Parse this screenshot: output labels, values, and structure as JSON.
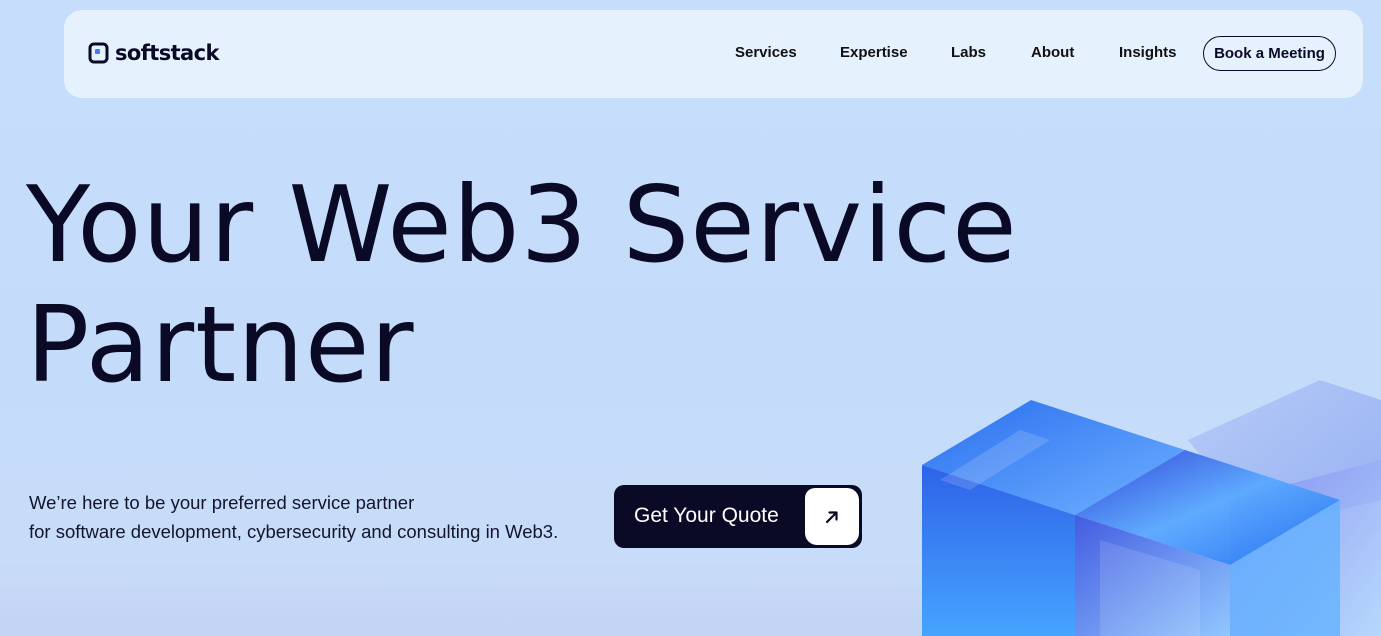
{
  "brand": {
    "name": "softstack",
    "logo_icon": "softstack-logo-icon"
  },
  "nav": {
    "items": [
      {
        "label": "Services"
      },
      {
        "label": "Expertise"
      },
      {
        "label": "Labs"
      },
      {
        "label": "About"
      },
      {
        "label": "Insights"
      }
    ],
    "cta_label": "Book a Meeting"
  },
  "hero": {
    "title_line1": "Your Web3 Service",
    "title_line2": "Partner",
    "subtitle_line1": "We’re here to be your preferred service partner",
    "subtitle_line2": "for software development, cybersecurity and consulting in Web3.",
    "cta_label": "Get Your Quote",
    "cta_icon": "arrow-up-right-icon"
  },
  "colors": {
    "background": "#c6defb",
    "navbar": "#e6f1fe",
    "text_dark": "#0b0a26",
    "cta_bg": "#0b0a26",
    "cube_blue": "#2f7bf0"
  }
}
